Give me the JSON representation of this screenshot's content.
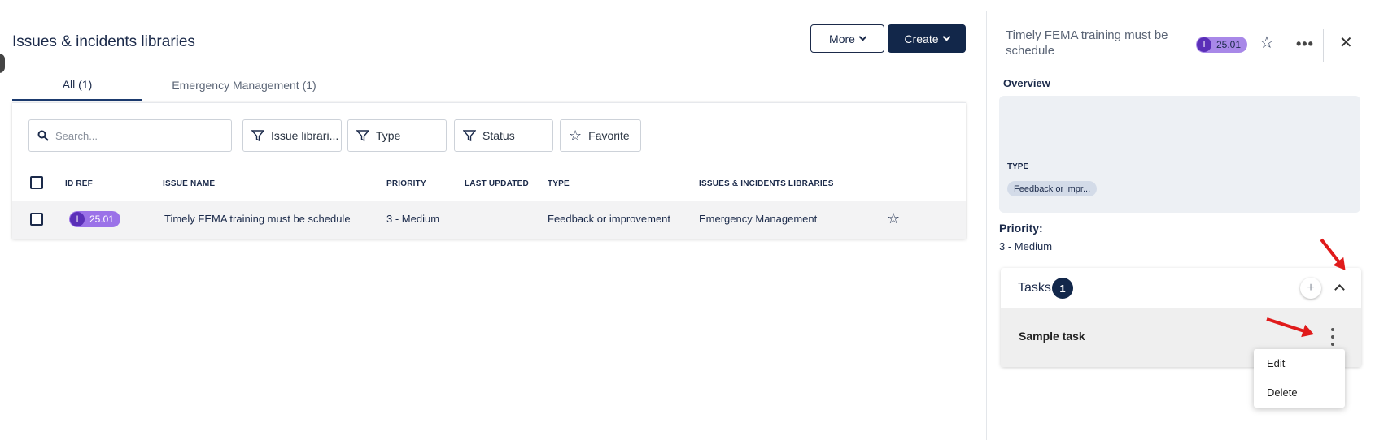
{
  "page": {
    "title": "Issues & incidents libraries",
    "more_label": "More",
    "create_label": "Create"
  },
  "tabs": [
    {
      "label": "All (1)",
      "active": true
    },
    {
      "label": "Emergency Management (1)",
      "active": false
    }
  ],
  "filters": {
    "search_placeholder": "Search...",
    "items": [
      "Issue librari...",
      "Type",
      "Status",
      "Favorite"
    ]
  },
  "table": {
    "columns": [
      "ID REF",
      "ISSUE NAME",
      "PRIORITY",
      "LAST UPDATED",
      "TYPE",
      "ISSUES & INCIDENTS LIBRARIES"
    ],
    "rows": [
      {
        "id_icon": "I",
        "id_ref": "25.01",
        "issue_name": "Timely FEMA training must be schedule",
        "priority": "3 - Medium",
        "last_updated": "",
        "type": "Feedback or improvement",
        "library": "Emergency Management"
      }
    ]
  },
  "drawer": {
    "title": "Timely FEMA training must be schedule",
    "badge_icon": "I",
    "badge_ref": "25.01",
    "overview_label": "Overview",
    "type_label": "TYPE",
    "type_chip": "Feedback or impr...",
    "priority_label": "Priority:",
    "priority_value": "3 - Medium",
    "tasks_label": "Tasks",
    "tasks_count": "1",
    "task_name": "Sample task",
    "menu": {
      "edit": "Edit",
      "delete": "Delete"
    }
  },
  "colors": {
    "navy": "#12274a",
    "badge_purple": "#9b72e8",
    "arrow_red": "#e01b1b"
  },
  "icons": [
    "search-icon",
    "filter-icon",
    "star-icon",
    "more-horizontal-icon",
    "close-icon",
    "plus-icon",
    "chevron-up-icon",
    "kebab-icon"
  ]
}
